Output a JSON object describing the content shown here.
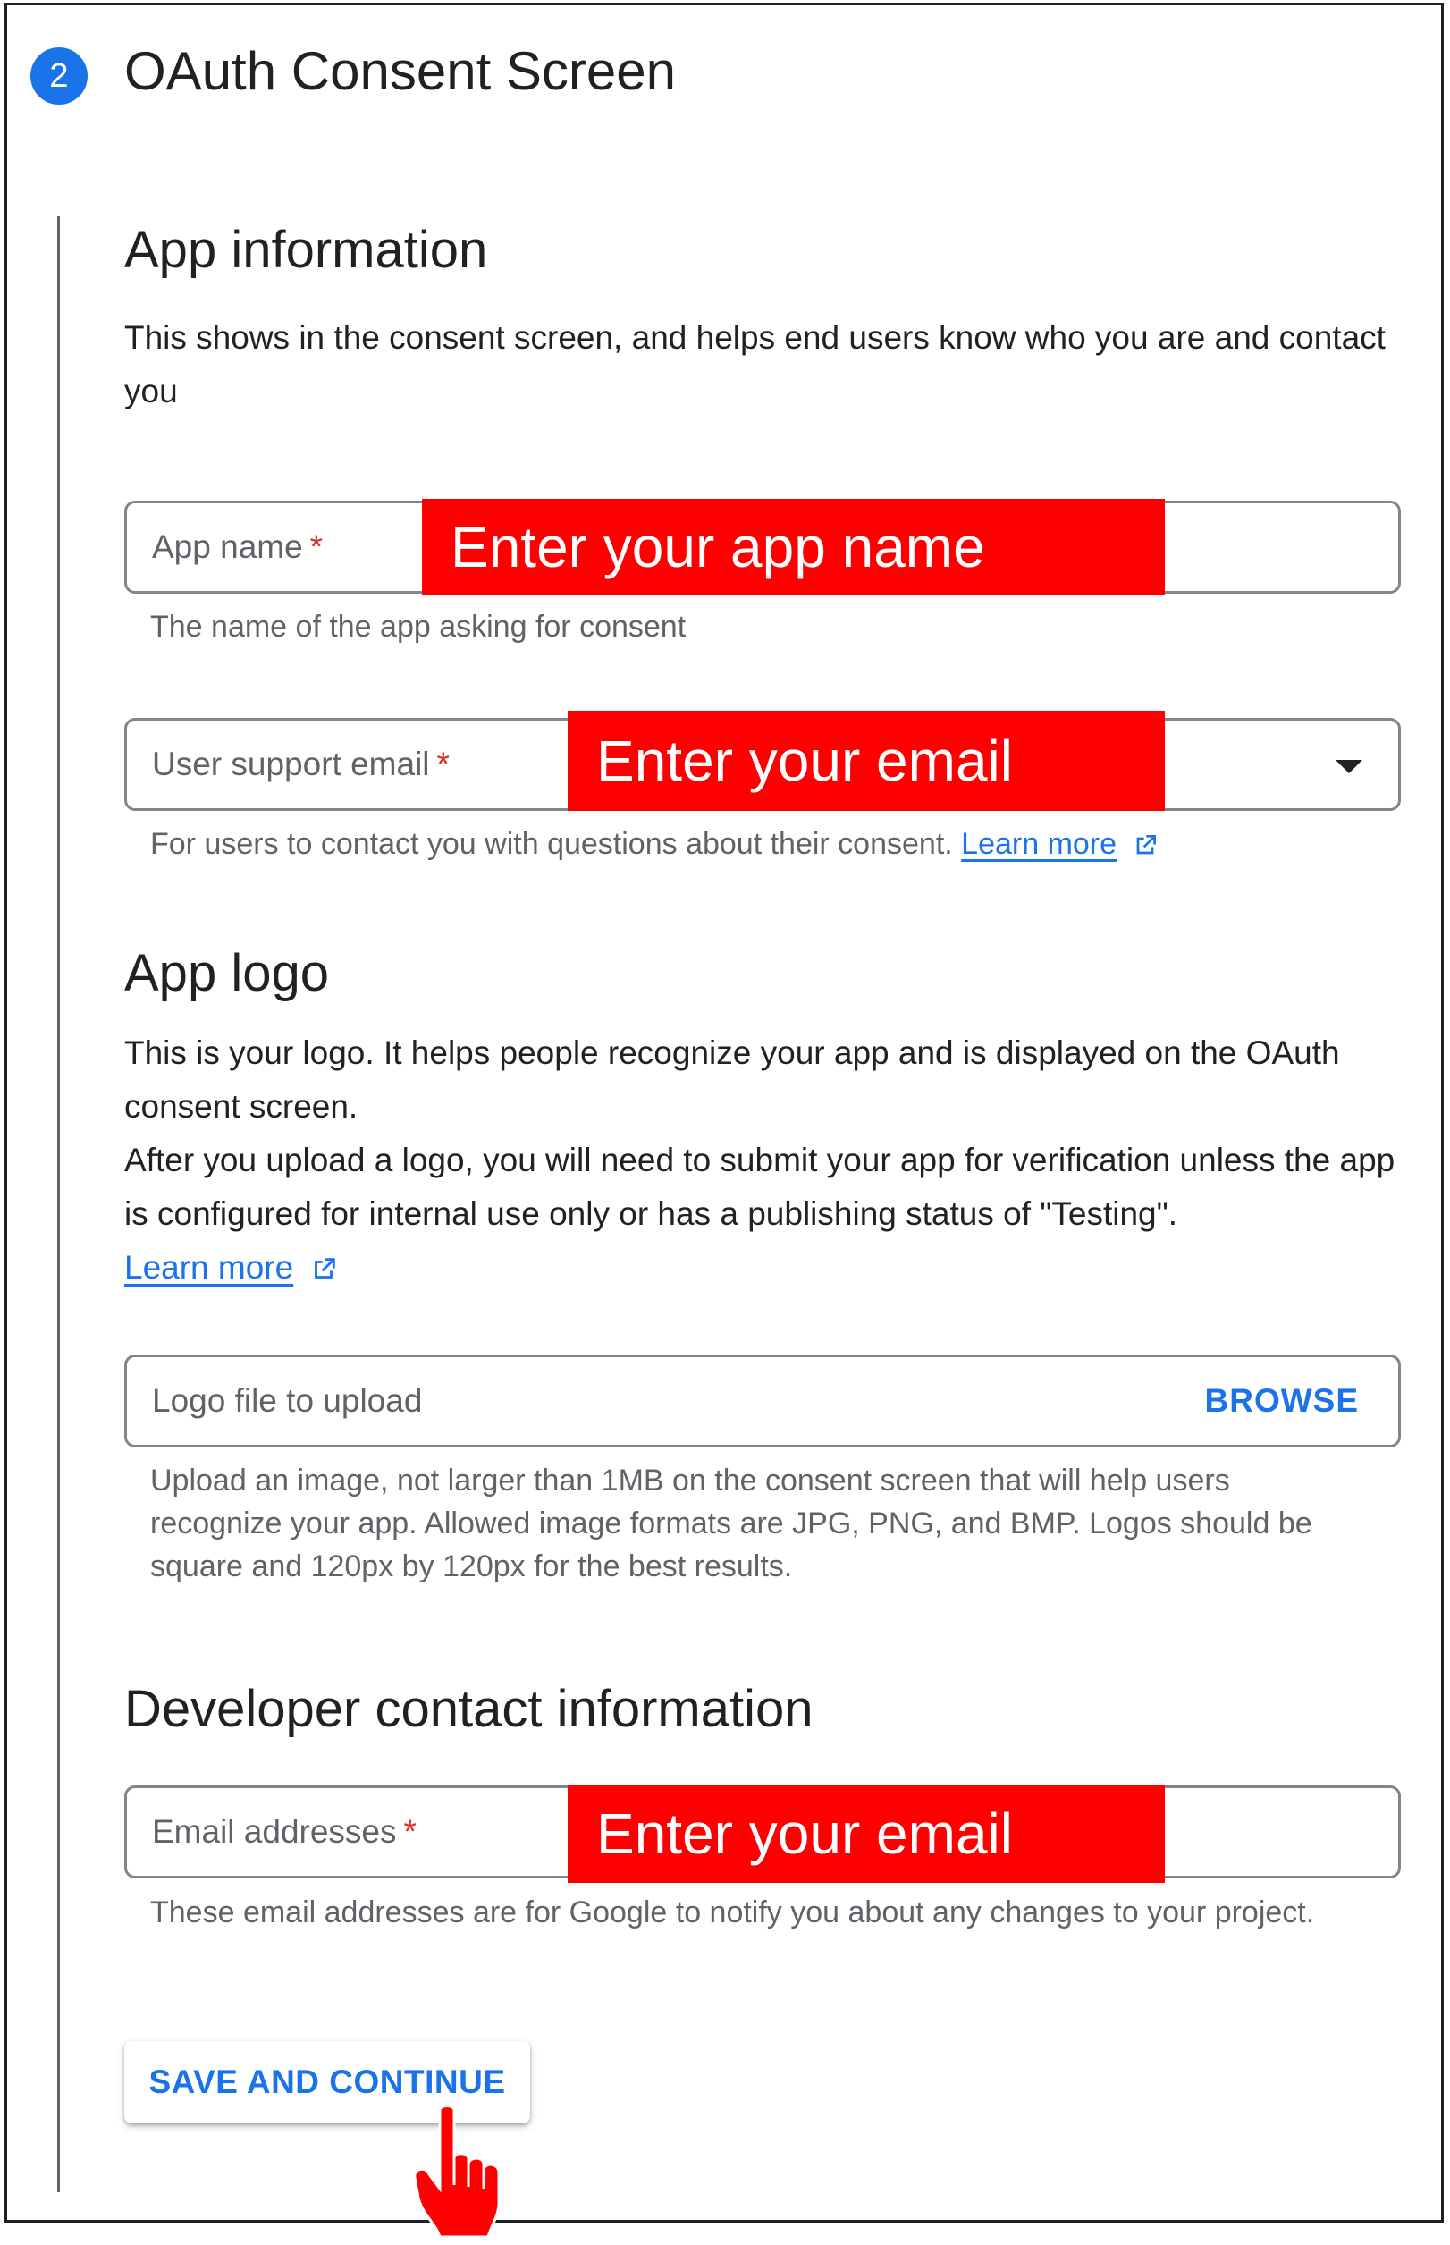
{
  "step": {
    "number": "2",
    "title": "OAuth Consent Screen"
  },
  "app_info": {
    "heading": "App information",
    "description": "This shows in the consent screen, and helps end users know who you are and contact you",
    "app_name": {
      "label": "App name",
      "required": "*",
      "hint": "The name of the app asking for consent"
    },
    "support_email": {
      "label": "User support email",
      "required": "*",
      "hint": "For users to contact you with questions about their consent.",
      "link": "Learn more"
    }
  },
  "app_logo": {
    "heading": "App logo",
    "description1": "This is your logo. It helps people recognize your app and is displayed on the OAuth consent screen.",
    "description2": "After you upload a logo, you will need to submit your app for verification unless the app is configured for internal use only or has a publishing status of \"Testing\".",
    "link": "Learn more",
    "field_label": "Logo file to upload",
    "browse_label": "BROWSE",
    "hint": "Upload an image, not larger than 1MB on the consent screen that will help users recognize your app. Allowed image formats are JPG, PNG, and BMP. Logos should be square and 120px by 120px for the best results."
  },
  "developer": {
    "heading": "Developer contact information",
    "field_label": "Email addresses",
    "required": "*",
    "hint": "These email addresses are for Google to notify you about any changes to your project."
  },
  "callouts": {
    "app_name": "Enter your app name",
    "support_email": "Enter your email",
    "developer_email": "Enter your email"
  },
  "save_button": "SAVE AND CONTINUE",
  "colors": {
    "accent": "#1a73e8",
    "callout": "#ff0000",
    "required": "#d93025"
  },
  "icons": [
    "open-in-new-icon",
    "dropdown-arrow-icon",
    "pointing-hand-icon"
  ]
}
